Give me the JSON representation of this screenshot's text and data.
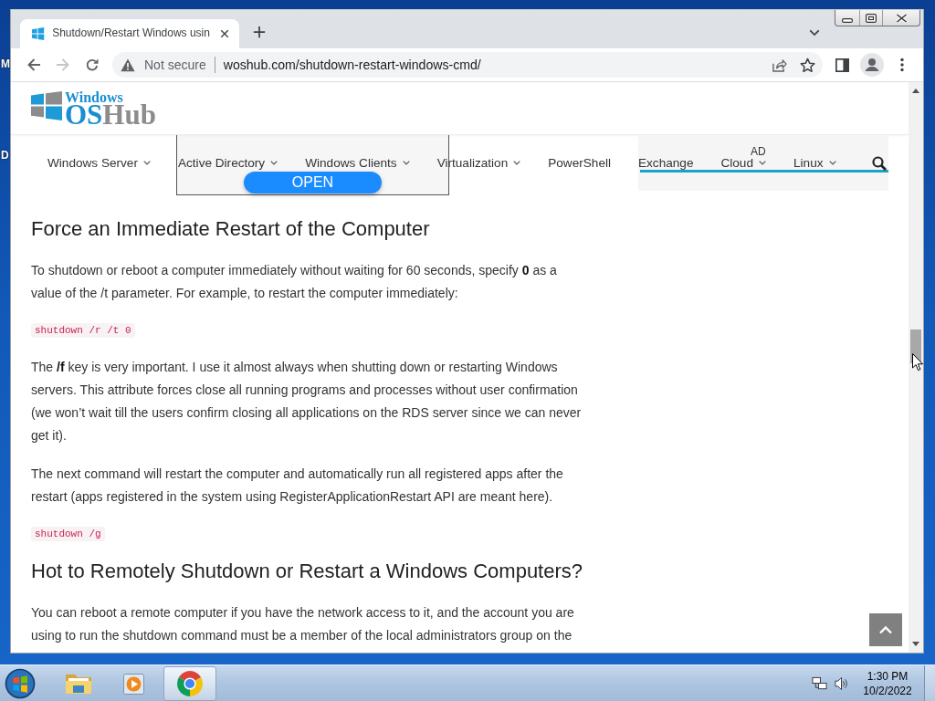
{
  "desktop": {
    "icon_labels": [
      "M",
      "D"
    ]
  },
  "browser": {
    "tabs": [
      {
        "title": "Shutdown/Restart Windows usin",
        "selected": true
      }
    ],
    "nav_buttons": [
      {
        "kind": "back",
        "disabled": false
      },
      {
        "kind": "forward",
        "disabled": true
      },
      {
        "kind": "reload",
        "disabled": false
      }
    ],
    "address_bar": {
      "security_label": "Not secure",
      "url": "woshub.com/shutdown-restart-windows-cmd/"
    }
  },
  "site": {
    "logo": {
      "tagline": "Windows",
      "name_parts": [
        {
          "text": "OS",
          "color": "#1a8fd0"
        },
        {
          "text": "Hub",
          "color": "#8c8c8c"
        }
      ]
    },
    "menu": [
      {
        "label": "Windows Server",
        "dropdown": true
      },
      {
        "label": "Active Directory",
        "dropdown": true
      },
      {
        "label": "Windows Clients",
        "dropdown": true
      },
      {
        "label": "Virtualization",
        "dropdown": true
      },
      {
        "label": "PowerShell",
        "dropdown": false
      },
      {
        "label": "Exchange",
        "dropdown": false
      },
      {
        "label": "Cloud",
        "dropdown": true
      },
      {
        "label": "Linux",
        "dropdown": true
      }
    ],
    "ad": {
      "button": "OPEN",
      "label": "AD"
    },
    "article": [
      {
        "kind": "heading",
        "text": "Force an Immediate Restart of the Computer"
      },
      {
        "kind": "paragraph",
        "text": "To shutdown or reboot a computer immediately without waiting for 60 seconds, specify **0** as a value of the /t parameter. For example, to restart the computer immediately:"
      },
      {
        "kind": "code",
        "text": "shutdown /r /t 0"
      },
      {
        "kind": "paragraph",
        "text": "The **/f** key is very important. I use it almost always when shutting down or restarting Windows servers. This attribute forces close all running programs and processes without user confirmation (we won’t wait till the users confirm closing all applications on the RDS server since we can never get it)."
      },
      {
        "kind": "paragraph",
        "text": "The next command will restart the computer and automatically run all registered apps after the restart (apps registered in the system using RegisterApplicationRestart API are meant here)."
      },
      {
        "kind": "code",
        "text": "shutdown /g"
      },
      {
        "kind": "heading",
        "text": "Hot to Remotely Shutdown or Restart a Windows Computers?"
      },
      {
        "kind": "paragraph",
        "text": "You can reboot a remote computer if you have the network access to it, and the account you are using to run the shutdown command must be a member of the local administrators group on the"
      }
    ]
  },
  "taskbar": {
    "apps": [
      {
        "kind": "folder",
        "active": false
      },
      {
        "kind": "media",
        "active": false
      },
      {
        "kind": "chrome",
        "active": true
      }
    ],
    "clock": {
      "time": "1:30 PM",
      "date": "10/2/2022"
    }
  }
}
